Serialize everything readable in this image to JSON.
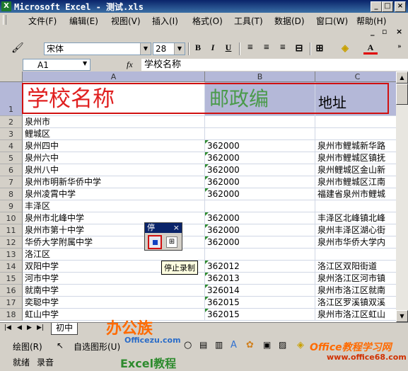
{
  "window": {
    "title": "Microsoft Excel - 测试.xls",
    "app_icon": "excel-icon"
  },
  "menu": [
    "文件(F)",
    "编辑(E)",
    "视图(V)",
    "插入(I)",
    "格式(O)",
    "工具(T)",
    "数据(D)",
    "窗口(W)",
    "帮助(H)"
  ],
  "format_toolbar": {
    "font": "宋体",
    "size": "28",
    "bold": "B",
    "italic": "I",
    "underline": "U",
    "font_color_label": "A"
  },
  "formula_bar": {
    "name_box": "A1",
    "fx": "fx",
    "content": "学校名称"
  },
  "columns": [
    "A",
    "B",
    "C"
  ],
  "header_row": {
    "a": "学校名称",
    "b": "邮政编",
    "c": "地址"
  },
  "rows": [
    {
      "n": "2",
      "a": "泉州市",
      "b": "",
      "c": ""
    },
    {
      "n": "3",
      "a": "鲤城区",
      "b": "",
      "c": ""
    },
    {
      "n": "4",
      "a": "泉州四中",
      "b": "362000",
      "c": "泉州市鲤城新华路"
    },
    {
      "n": "5",
      "a": "泉州六中",
      "b": "362000",
      "c": "泉州市鲤城区镇抚"
    },
    {
      "n": "6",
      "a": "泉州八中",
      "b": "362000",
      "c": "泉州鲤城区金山新"
    },
    {
      "n": "7",
      "a": "泉州市明新华侨中学",
      "b": "362000",
      "c": "泉州市鲤城区江南"
    },
    {
      "n": "8",
      "a": "泉州凌霄中学",
      "b": "362000",
      "c": "福建省泉州市鲤城"
    },
    {
      "n": "9",
      "a": "丰泽区",
      "b": "",
      "c": ""
    },
    {
      "n": "10",
      "a": "泉州市北峰中学",
      "b": "362000",
      "c": "丰泽区北峰镇北峰"
    },
    {
      "n": "11",
      "a": "泉州市第十中学",
      "b": "362000",
      "c": "泉州丰泽区湖心街"
    },
    {
      "n": "12",
      "a": "华侨大学附属中学",
      "b": "362000",
      "c": "泉州市华侨大学内"
    },
    {
      "n": "13",
      "a": "洛江区",
      "b": "",
      "c": ""
    },
    {
      "n": "14",
      "a": "双阳中学",
      "b": "362012",
      "c": "洛江区双阳街道"
    },
    {
      "n": "15",
      "a": "河市中学",
      "b": "362013",
      "c": "泉州洛江区河市镇"
    },
    {
      "n": "16",
      "a": "就南中学",
      "b": "326014",
      "c": "泉州市洛江区就南"
    },
    {
      "n": "17",
      "a": "奕聪中学",
      "b": "362015",
      "c": "洛江区罗溪镇双溪"
    },
    {
      "n": "18",
      "a": "虹山中学",
      "b": "362015",
      "c": "泉州市洛江区虹山"
    }
  ],
  "stop_toolbar": {
    "title": "停",
    "tooltip": "停止录制"
  },
  "sheet_tab": "初中",
  "draw_toolbar": {
    "draw": "绘图(R)",
    "autoshape": "自选图形(U)"
  },
  "status": {
    "ready": "就绪",
    "record": "录音"
  },
  "watermarks": {
    "bangong": "办公族",
    "site": "Officezu.com",
    "excel": "Excel教程",
    "office68": "Office教程学习网",
    "office68_url": "www.office68.com"
  },
  "colors": {
    "red": "#e02020",
    "green": "#4a9a4a",
    "header_fill": "#b4b8d8",
    "selection_border": "#d01010"
  }
}
